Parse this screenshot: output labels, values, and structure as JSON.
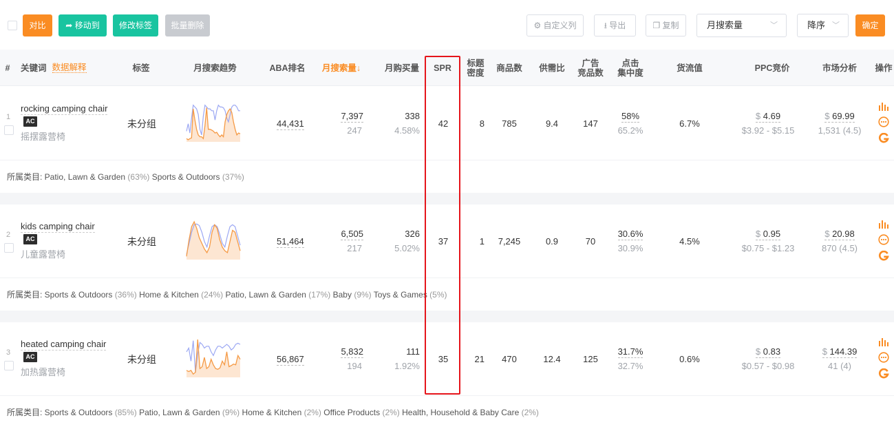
{
  "toolbar": {
    "compare_label": "对比",
    "move_label": "移动到",
    "edit_tag_label": "修改标签",
    "batch_delete_label": "批量删除",
    "custom_columns_label": "自定义列",
    "export_label": "导出",
    "copy_label": "复制",
    "sort_field_value": "月搜索量",
    "sort_order_value": "降序",
    "confirm_label": "确定"
  },
  "colors": {
    "accent": "#fa8c23",
    "teal": "#19c4a0",
    "highlight": "#e5141a",
    "trend_blue": "#9ba7f3",
    "trend_orange": "#f59a45"
  },
  "header": {
    "index": "#",
    "keyword": "关键词",
    "explain": "数据解释",
    "tag": "标签",
    "trend": "月搜索趋势",
    "aba": "ABA排名",
    "monthly_search": "月搜索量↓",
    "monthly_purchase": "月购买量",
    "spr": "SPR",
    "title_density": "标题\n密度",
    "product_count": "商品数",
    "supply_demand": "供需比",
    "ad_products": "广告\n竞品数",
    "click_concentration": "点击\n集中度",
    "gmv": "货流值",
    "ppc": "PPC竞价",
    "market": "市场分析",
    "ops": "操作"
  },
  "category_prefix": "所属类目: ",
  "rows": [
    {
      "index": "1",
      "keyword": "rocking camping chair",
      "badge": "AC",
      "translation": "摇摆露营椅",
      "tag": "未分组",
      "aba": "44,431",
      "search": "7,397",
      "search_sub": "247",
      "purchase": "338",
      "purchase_sub": "4.58%",
      "spr": "42",
      "title_density": "8",
      "products": "785",
      "supply_demand": "9.4",
      "ad_products": "147",
      "click": "58%",
      "click_sub": "65.2%",
      "gmv": "6.7%",
      "ppc_sym": "$",
      "ppc": "4.69",
      "ppc_range": "$3.92 - $5.15",
      "market_sym": "$",
      "market": "69.99",
      "market_sub": "1,531 (4.5)",
      "trend_blue": [
        0.75,
        0.55,
        0.8,
        0.4,
        0.05,
        0.1,
        0.15,
        0.3,
        0.7,
        0.85,
        0.35,
        0.05,
        0.1,
        0.15,
        0.15,
        0.2,
        0.2,
        0.45,
        0.2,
        0.05,
        0.1,
        0.1,
        0.12,
        0.2,
        0.4,
        0.5,
        0.3,
        0.1,
        0.05,
        0.05,
        0.1,
        0.2,
        0.2
      ],
      "trend_orange": [
        0.95,
        0.98,
        0.95,
        0.93,
        0.15,
        0.45,
        0.7,
        0.85,
        0.9,
        0.9,
        0.95,
        0.6,
        0.12,
        0.7,
        0.7,
        0.72,
        0.75,
        0.8,
        0.78,
        0.85,
        0.9,
        0.85,
        0.9,
        0.5,
        0.3,
        0.2,
        0.15,
        0.25,
        0.5,
        0.7,
        0.85,
        0.8,
        0.82
      ],
      "categories": [
        {
          "name": "Patio, Lawn & Garden",
          "pct": "(63%)"
        },
        {
          "name": "Sports & Outdoors",
          "pct": "(37%)"
        }
      ]
    },
    {
      "index": "2",
      "keyword": "kids camping chair",
      "badge": "AC",
      "translation": "儿童露营椅",
      "tag": "未分组",
      "aba": "51,464",
      "search": "6,505",
      "search_sub": "217",
      "purchase": "326",
      "purchase_sub": "5.02%",
      "spr": "37",
      "title_density": "1",
      "products": "7,245",
      "supply_demand": "0.9",
      "ad_products": "70",
      "click": "30.6%",
      "click_sub": "30.9%",
      "gmv": "4.5%",
      "ppc_sym": "$",
      "ppc": "0.95",
      "ppc_range": "$0.75 - $1.23",
      "market_sym": "$",
      "market": "20.98",
      "market_sub": "870 (4.5)",
      "trend_blue": [
        0.9,
        0.6,
        0.3,
        0.1,
        0.08,
        0.12,
        0.3,
        0.55,
        0.7,
        0.4,
        0.15,
        0.1,
        0.15,
        0.35,
        0.6,
        0.7,
        0.4,
        0.15,
        0.1,
        0.15,
        0.4,
        0.65
      ],
      "trend_orange": [
        0.95,
        0.5,
        0.15,
        0.02,
        0.2,
        0.45,
        0.6,
        0.75,
        0.85,
        0.7,
        0.3,
        0.1,
        0.2,
        0.5,
        0.7,
        0.8,
        0.85,
        0.55,
        0.25,
        0.3,
        0.55,
        0.8
      ],
      "categories": [
        {
          "name": "Sports & Outdoors",
          "pct": "(36%)"
        },
        {
          "name": "Home & Kitchen",
          "pct": "(24%)"
        },
        {
          "name": "Patio, Lawn & Garden",
          "pct": "(17%)"
        },
        {
          "name": "Baby",
          "pct": "(9%)"
        },
        {
          "name": "Toys & Games",
          "pct": "(5%)"
        }
      ]
    },
    {
      "index": "3",
      "keyword": "heated camping chair",
      "badge": "AC",
      "translation": "加热露营椅",
      "tag": "未分组",
      "aba": "56,867",
      "search": "5,832",
      "search_sub": "194",
      "purchase": "111",
      "purchase_sub": "1.92%",
      "spr": "35",
      "title_density": "21",
      "products": "470",
      "supply_demand": "12.4",
      "ad_products": "125",
      "click": "31.7%",
      "click_sub": "32.7%",
      "gmv": "0.6%",
      "ppc_sym": "$",
      "ppc": "0.83",
      "ppc_range": "$0.57 - $0.98",
      "market_sym": "$",
      "market": "144.39",
      "market_sub": "41 (4)",
      "trend_blue": [
        0.35,
        0.25,
        0.6,
        0.05,
        0.9,
        0.4,
        0.1,
        0.15,
        0.25,
        0.2,
        0.2,
        0.35,
        0.45,
        0.3,
        0.2,
        0.2,
        0.25,
        0.2,
        0.15,
        0.2,
        0.3,
        0.25,
        0.15,
        0.12,
        0.15
      ],
      "trend_orange": [
        0.85,
        0.88,
        0.85,
        0.95,
        0.9,
        0.02,
        0.8,
        0.75,
        0.5,
        0.8,
        0.75,
        0.55,
        0.7,
        0.8,
        0.82,
        0.78,
        0.6,
        0.7,
        0.35,
        0.75,
        0.72,
        0.68,
        0.7,
        0.45,
        0.55
      ],
      "categories": [
        {
          "name": "Sports & Outdoors",
          "pct": "(85%)"
        },
        {
          "name": "Patio, Lawn & Garden",
          "pct": "(9%)"
        },
        {
          "name": "Home & Kitchen",
          "pct": "(2%)"
        },
        {
          "name": "Office Products",
          "pct": "(2%)"
        },
        {
          "name": "Health, Household & Baby Care",
          "pct": "(2%)"
        }
      ]
    }
  ]
}
